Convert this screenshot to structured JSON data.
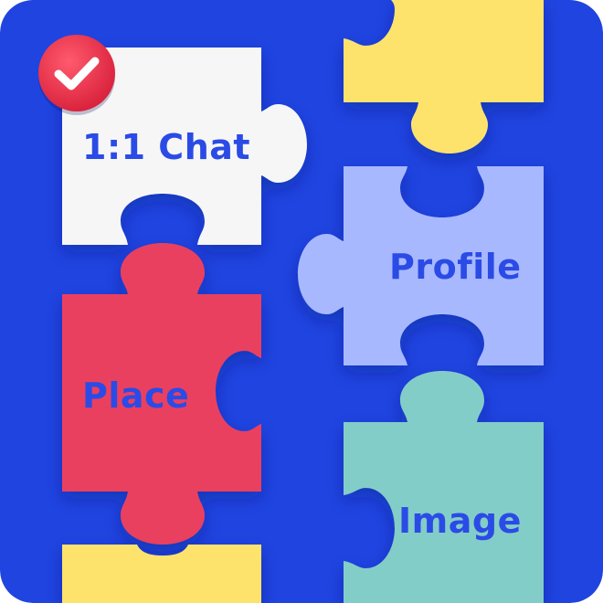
{
  "colors": {
    "background": "#1F44E0",
    "white_piece": "#F6F6F6",
    "yellow_piece": "#FDE36C",
    "lavender_piece": "#A8B8FF",
    "red_piece": "#EA3F5E",
    "teal_piece": "#83CDC8",
    "label_text": "#2B4BE6",
    "badge": "#EE3048"
  },
  "pieces": [
    {
      "id": "chat",
      "label": "1:1 Chat",
      "color": "white_piece",
      "selected": true
    },
    {
      "id": "profile",
      "label": "Profile",
      "color": "lavender_piece",
      "selected": false
    },
    {
      "id": "place",
      "label": "Place",
      "color": "red_piece",
      "selected": false
    },
    {
      "id": "image",
      "label": "Image",
      "color": "teal_piece",
      "selected": false
    },
    {
      "id": "top-right",
      "label": "",
      "color": "yellow_piece",
      "selected": false
    },
    {
      "id": "bottom-left",
      "label": "",
      "color": "yellow_piece",
      "selected": false
    }
  ],
  "badge": {
    "icon": "checkmark-icon",
    "state": "selected"
  }
}
